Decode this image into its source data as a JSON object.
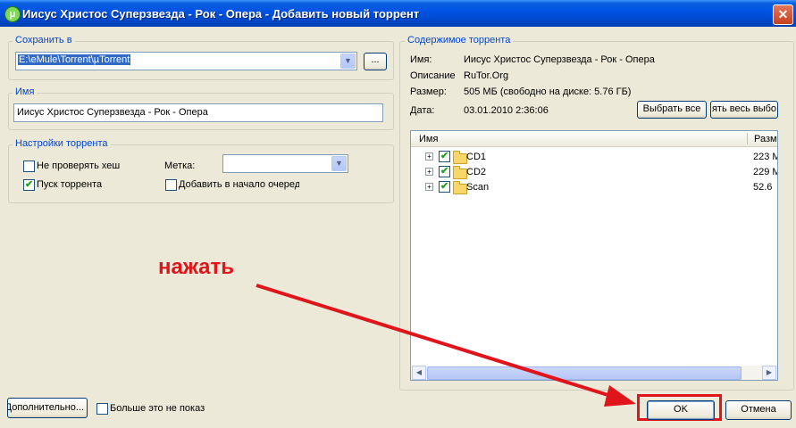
{
  "window": {
    "title": "Иисус Христос Суперзвезда - Рок - Опера - Добавить новый торрент",
    "close_glyph": "✕",
    "app_icon_glyph": "μ"
  },
  "save_in": {
    "legend": "Сохранить в",
    "path": "E:\\eMule\\Torrent\\µTorrent",
    "browse_label": "..."
  },
  "name_group": {
    "legend": "Имя",
    "value": "Иисус Христос Суперзвезда - Рок - Опера"
  },
  "torrent_settings": {
    "legend": "Настройки торрента",
    "skip_hash_label": "Не проверять хеш",
    "skip_hash_checked": false,
    "start_torrent_label": "Пуск торрента",
    "start_torrent_checked": true,
    "label_caption": "Метка:",
    "label_value": "",
    "add_to_top_label": "Добавить в начало очеред",
    "add_to_top_checked": false
  },
  "contents": {
    "legend": "Содержимое торрента",
    "name_caption": "Имя:",
    "name_value": "Иисус Христос Суперзвезда - Рок - Опера",
    "desc_caption": "Описание",
    "desc_value": "RuTor.Org",
    "size_caption": "Размер:",
    "size_value": "505 МБ (свободно на диске: 5.76 ГБ)",
    "date_caption": "Дата:",
    "date_value": "03.01.2010 2:36:06",
    "select_all_label": "Выбрать все",
    "deselect_all_label": "ять весь выбо",
    "columns": {
      "name": "Имя",
      "size": "Разм"
    },
    "files": [
      {
        "name": "CD1",
        "size": "223 M",
        "checked": true
      },
      {
        "name": "CD2",
        "size": "229 M",
        "checked": true
      },
      {
        "name": "Scan",
        "size": "52.6",
        "checked": true
      }
    ]
  },
  "footer": {
    "advanced_label": "Дополнительно...",
    "dont_show_label": "Больше это не показ",
    "dont_show_checked": false,
    "ok_label": "OK",
    "cancel_label": "Отмена"
  },
  "annotation": {
    "text": "нажать",
    "color": "#e0151b"
  },
  "colors": {
    "title_bar": "#0054e3",
    "dialog_bg": "#ece9d8",
    "group_legend": "#0046d5",
    "annotation_red": "#e0151b"
  }
}
